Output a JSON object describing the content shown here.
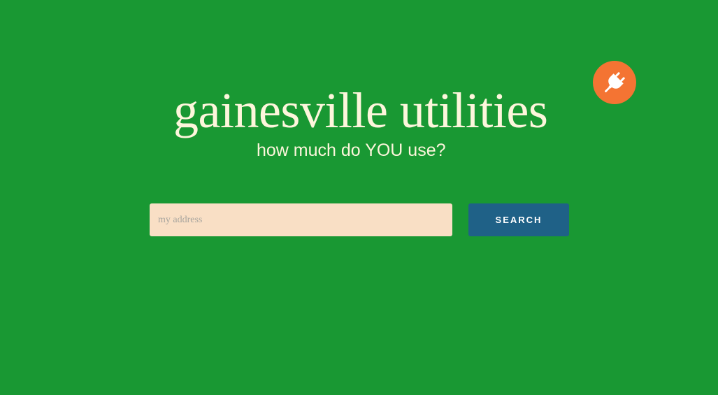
{
  "header": {
    "title": "gainesville utilities",
    "subtitle": "how much do YOU use?",
    "badge_icon": "plug-icon"
  },
  "search": {
    "placeholder": "my address",
    "value": "",
    "button_label": "SEARCH"
  },
  "colors": {
    "background": "#199833",
    "title_text": "#fdf6dc",
    "badge": "#f47433",
    "input_background": "#f9dfc5",
    "button_background": "#1f6187",
    "button_text": "#ffffff"
  }
}
